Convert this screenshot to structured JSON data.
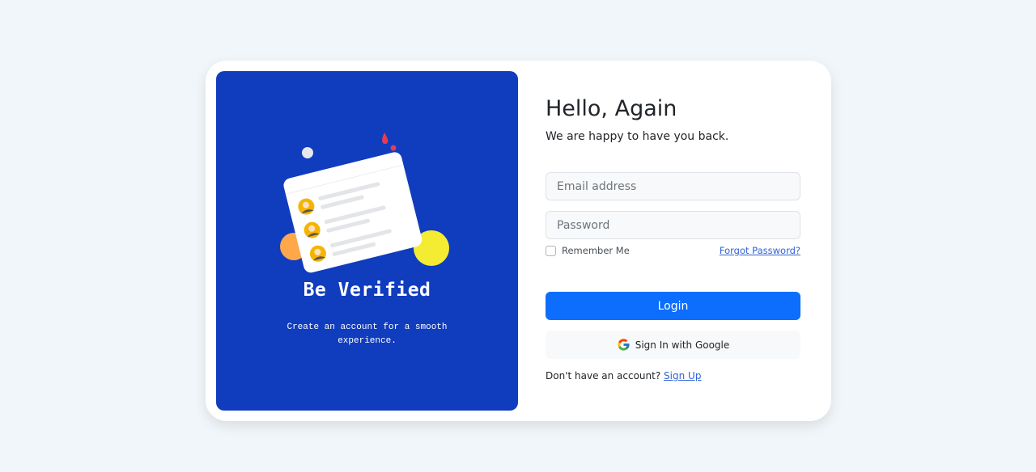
{
  "left": {
    "title": "Be Verified",
    "subtitle": "Create an account for a smooth experience."
  },
  "form": {
    "greeting": "Hello, Again",
    "subtitle": "We are happy to have you back.",
    "email_placeholder": "Email address",
    "password_placeholder": "Password",
    "remember_label": "Remember Me",
    "remember_checked": false,
    "forgot_label": "Forgot Password?",
    "login_label": "Login",
    "google_label": "Sign In with Google",
    "signup_prompt": "Don't have an account?",
    "signup_label": "Sign Up"
  },
  "colors": {
    "page_bg": "#f0f6f9",
    "panel_blue": "#103cbe",
    "primary": "#0d6efd",
    "link": "#3163d6",
    "accent_yellow": "#f4ec33",
    "accent_orange": "#ffa84b",
    "accent_red": "#e63c50"
  },
  "icons": {
    "illustration": "user-list-card-illustration",
    "google": "google-g-icon"
  }
}
